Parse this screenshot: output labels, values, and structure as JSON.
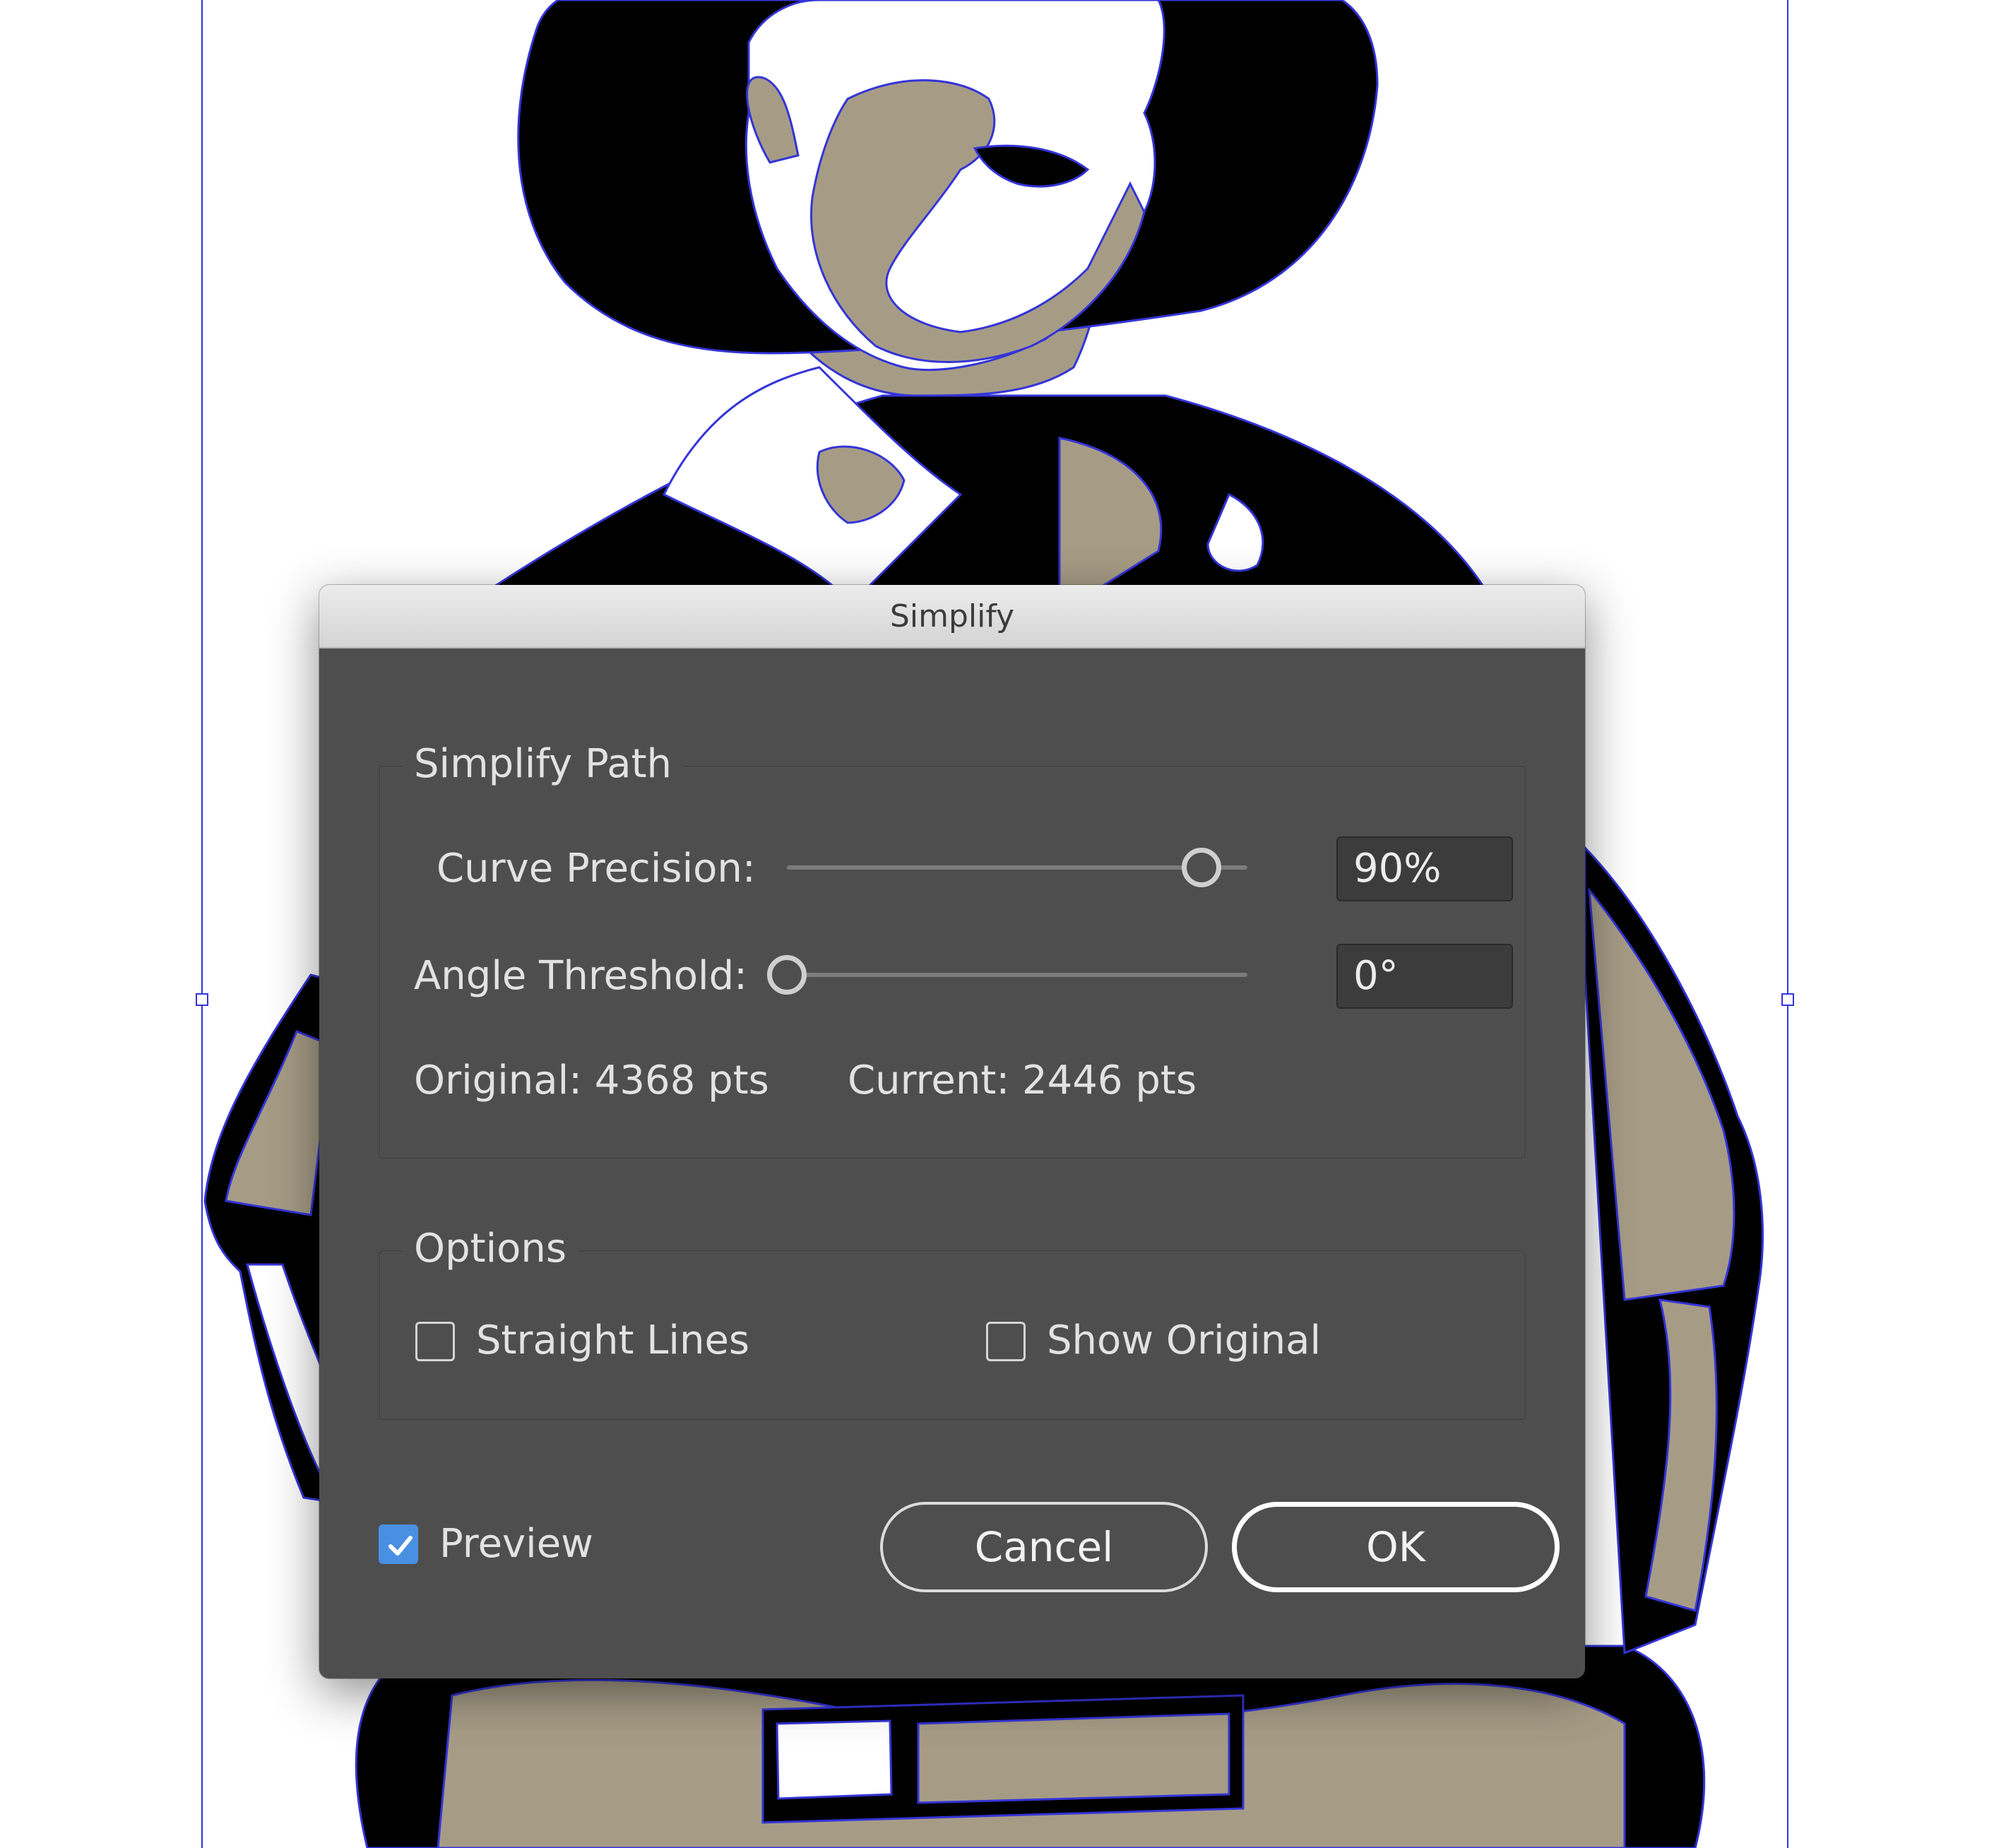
{
  "dialog": {
    "title": "Simplify",
    "simplify_path": {
      "group_title": "Simplify Path",
      "curve_precision_label": "Curve Precision:",
      "curve_precision_value": "90%",
      "curve_precision_level": 0.9,
      "angle_threshold_label": "Angle Threshold:",
      "angle_threshold_value": "0°",
      "angle_threshold_level": 0,
      "original_text": "Original: 4368 pts",
      "current_text": "Current: 2446 pts"
    },
    "options": {
      "group_title": "Options",
      "straight_lines_label": "Straight Lines",
      "straight_lines_checked": false,
      "show_original_label": "Show Original",
      "show_original_checked": false
    },
    "preview_label": "Preview",
    "preview_checked": true,
    "cancel_label": "Cancel",
    "ok_label": "OK"
  },
  "colors": {
    "dialog_bg": "#4e4e4e",
    "accent": "#4a90e2",
    "selection": "#3434d8",
    "art_fill": "#a69c86",
    "art_ink": "#000000"
  }
}
